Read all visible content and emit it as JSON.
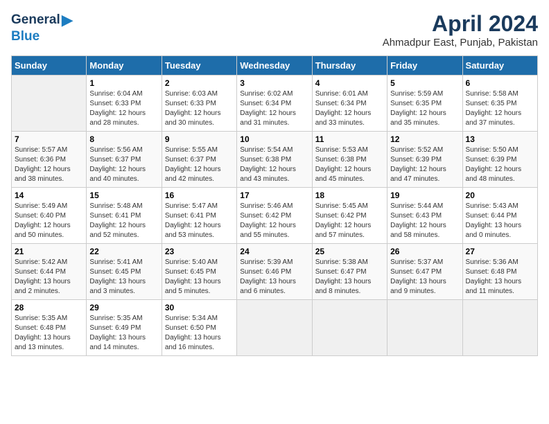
{
  "header": {
    "logo_general": "General",
    "logo_blue": "Blue",
    "month_title": "April 2024",
    "location": "Ahmadpur East, Punjab, Pakistan"
  },
  "weekdays": [
    "Sunday",
    "Monday",
    "Tuesday",
    "Wednesday",
    "Thursday",
    "Friday",
    "Saturday"
  ],
  "weeks": [
    [
      {
        "day": "",
        "info": ""
      },
      {
        "day": "1",
        "info": "Sunrise: 6:04 AM\nSunset: 6:33 PM\nDaylight: 12 hours\nand 28 minutes."
      },
      {
        "day": "2",
        "info": "Sunrise: 6:03 AM\nSunset: 6:33 PM\nDaylight: 12 hours\nand 30 minutes."
      },
      {
        "day": "3",
        "info": "Sunrise: 6:02 AM\nSunset: 6:34 PM\nDaylight: 12 hours\nand 31 minutes."
      },
      {
        "day": "4",
        "info": "Sunrise: 6:01 AM\nSunset: 6:34 PM\nDaylight: 12 hours\nand 33 minutes."
      },
      {
        "day": "5",
        "info": "Sunrise: 5:59 AM\nSunset: 6:35 PM\nDaylight: 12 hours\nand 35 minutes."
      },
      {
        "day": "6",
        "info": "Sunrise: 5:58 AM\nSunset: 6:35 PM\nDaylight: 12 hours\nand 37 minutes."
      }
    ],
    [
      {
        "day": "7",
        "info": "Sunrise: 5:57 AM\nSunset: 6:36 PM\nDaylight: 12 hours\nand 38 minutes."
      },
      {
        "day": "8",
        "info": "Sunrise: 5:56 AM\nSunset: 6:37 PM\nDaylight: 12 hours\nand 40 minutes."
      },
      {
        "day": "9",
        "info": "Sunrise: 5:55 AM\nSunset: 6:37 PM\nDaylight: 12 hours\nand 42 minutes."
      },
      {
        "day": "10",
        "info": "Sunrise: 5:54 AM\nSunset: 6:38 PM\nDaylight: 12 hours\nand 43 minutes."
      },
      {
        "day": "11",
        "info": "Sunrise: 5:53 AM\nSunset: 6:38 PM\nDaylight: 12 hours\nand 45 minutes."
      },
      {
        "day": "12",
        "info": "Sunrise: 5:52 AM\nSunset: 6:39 PM\nDaylight: 12 hours\nand 47 minutes."
      },
      {
        "day": "13",
        "info": "Sunrise: 5:50 AM\nSunset: 6:39 PM\nDaylight: 12 hours\nand 48 minutes."
      }
    ],
    [
      {
        "day": "14",
        "info": "Sunrise: 5:49 AM\nSunset: 6:40 PM\nDaylight: 12 hours\nand 50 minutes."
      },
      {
        "day": "15",
        "info": "Sunrise: 5:48 AM\nSunset: 6:41 PM\nDaylight: 12 hours\nand 52 minutes."
      },
      {
        "day": "16",
        "info": "Sunrise: 5:47 AM\nSunset: 6:41 PM\nDaylight: 12 hours\nand 53 minutes."
      },
      {
        "day": "17",
        "info": "Sunrise: 5:46 AM\nSunset: 6:42 PM\nDaylight: 12 hours\nand 55 minutes."
      },
      {
        "day": "18",
        "info": "Sunrise: 5:45 AM\nSunset: 6:42 PM\nDaylight: 12 hours\nand 57 minutes."
      },
      {
        "day": "19",
        "info": "Sunrise: 5:44 AM\nSunset: 6:43 PM\nDaylight: 12 hours\nand 58 minutes."
      },
      {
        "day": "20",
        "info": "Sunrise: 5:43 AM\nSunset: 6:44 PM\nDaylight: 13 hours\nand 0 minutes."
      }
    ],
    [
      {
        "day": "21",
        "info": "Sunrise: 5:42 AM\nSunset: 6:44 PM\nDaylight: 13 hours\nand 2 minutes."
      },
      {
        "day": "22",
        "info": "Sunrise: 5:41 AM\nSunset: 6:45 PM\nDaylight: 13 hours\nand 3 minutes."
      },
      {
        "day": "23",
        "info": "Sunrise: 5:40 AM\nSunset: 6:45 PM\nDaylight: 13 hours\nand 5 minutes."
      },
      {
        "day": "24",
        "info": "Sunrise: 5:39 AM\nSunset: 6:46 PM\nDaylight: 13 hours\nand 6 minutes."
      },
      {
        "day": "25",
        "info": "Sunrise: 5:38 AM\nSunset: 6:47 PM\nDaylight: 13 hours\nand 8 minutes."
      },
      {
        "day": "26",
        "info": "Sunrise: 5:37 AM\nSunset: 6:47 PM\nDaylight: 13 hours\nand 9 minutes."
      },
      {
        "day": "27",
        "info": "Sunrise: 5:36 AM\nSunset: 6:48 PM\nDaylight: 13 hours\nand 11 minutes."
      }
    ],
    [
      {
        "day": "28",
        "info": "Sunrise: 5:35 AM\nSunset: 6:48 PM\nDaylight: 13 hours\nand 13 minutes."
      },
      {
        "day": "29",
        "info": "Sunrise: 5:35 AM\nSunset: 6:49 PM\nDaylight: 13 hours\nand 14 minutes."
      },
      {
        "day": "30",
        "info": "Sunrise: 5:34 AM\nSunset: 6:50 PM\nDaylight: 13 hours\nand 16 minutes."
      },
      {
        "day": "",
        "info": ""
      },
      {
        "day": "",
        "info": ""
      },
      {
        "day": "",
        "info": ""
      },
      {
        "day": "",
        "info": ""
      }
    ]
  ]
}
